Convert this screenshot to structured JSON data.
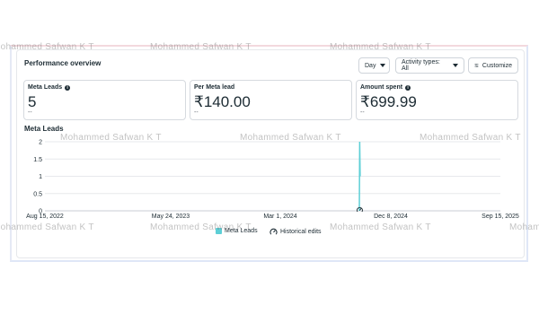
{
  "page": {
    "title": "Performance overview",
    "controls": {
      "day_label": "Day",
      "activity_label": "Activity types: All",
      "customize_label": "Customize"
    }
  },
  "metrics": [
    {
      "label": "Meta Leads",
      "value": "5",
      "delta": "--",
      "has_info": true
    },
    {
      "label": "Per Meta lead",
      "value": "₹140.00",
      "delta": "--",
      "has_info": false
    },
    {
      "label": "Amount spent",
      "value": "₹699.99",
      "delta": "--",
      "has_info": true
    }
  ],
  "chart_title": "Meta Leads",
  "chart_data": {
    "type": "line",
    "y_ticks": [
      "2",
      "1.5",
      "1",
      "0.5",
      "0"
    ],
    "x_ticks": [
      "Aug 15, 2022",
      "May 24, 2023",
      "Mar 1, 2024",
      "Dec 8, 2024",
      "Sep 15, 2025"
    ],
    "ylim": [
      0,
      2
    ],
    "xlim": [
      "2022-08-15",
      "2025-09-15"
    ],
    "series": [
      {
        "name": "Meta Leads",
        "points": [
          {
            "x": "2024-10-01",
            "y": 0
          },
          {
            "x": "2024-10-02",
            "y": 2
          },
          {
            "x": "2024-10-03",
            "y": 1
          }
        ]
      }
    ],
    "historical_edit_markers": [
      "2024-10-02"
    ],
    "grid": true,
    "legend": "bottom-center",
    "color": "#5dcfd6"
  },
  "legend": {
    "series_label": "Meta Leads",
    "edits_label": "Historical edits"
  },
  "watermark": "Mohammed Safwan K T"
}
